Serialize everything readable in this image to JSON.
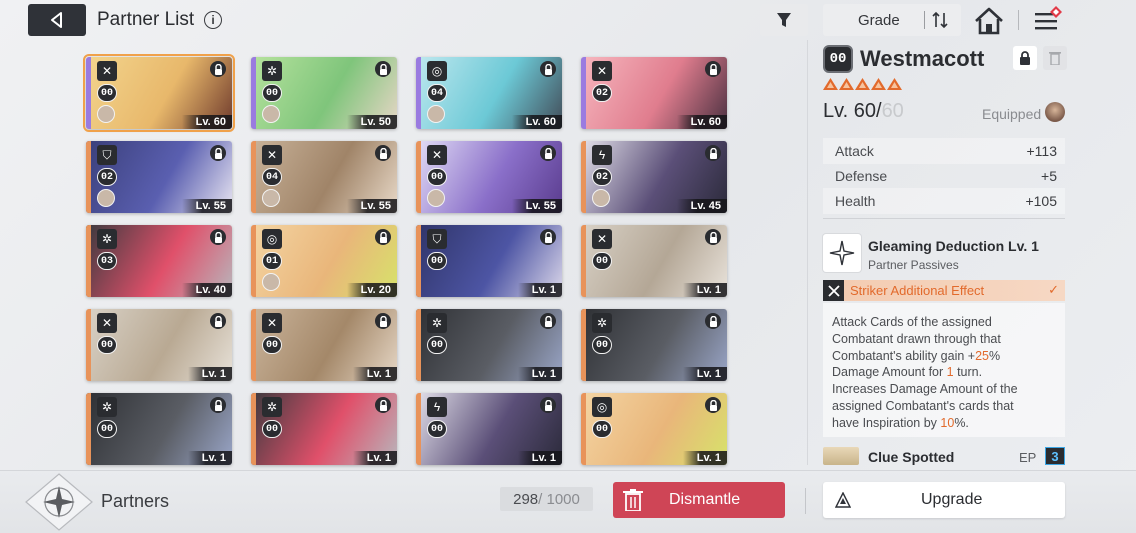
{
  "header": {
    "title": "Partner List",
    "sort_label": "Grade"
  },
  "partners": [
    {
      "grade": "00",
      "level": "Lv. 60",
      "type": "striker",
      "stripe": "#9a7be0",
      "bg": [
        "#f3d58e",
        "#e8b86b",
        "#6f3a2c"
      ],
      "selected": true,
      "equipped": true
    },
    {
      "grade": "00",
      "level": "Lv. 50",
      "type": "gear",
      "stripe": "#9a7be0",
      "bg": [
        "#b7e39e",
        "#7fc57b",
        "#e7d6c6"
      ],
      "selected": false,
      "equipped": true
    },
    {
      "grade": "04",
      "level": "Lv. 60",
      "type": "target",
      "stripe": "#9a7be0",
      "bg": [
        "#bfe8ef",
        "#6cc9d6",
        "#424c58"
      ],
      "selected": false,
      "equipped": true
    },
    {
      "grade": "02",
      "level": "Lv. 60",
      "type": "striker",
      "stripe": "#9a7be0",
      "bg": [
        "#f7b7bf",
        "#e07d8e",
        "#4a3040"
      ],
      "selected": false,
      "equipped": false
    },
    {
      "grade": "02",
      "level": "Lv. 55",
      "type": "shield",
      "stripe": "#e8935a",
      "bg": [
        "#3a3f7a",
        "#5a5fb0",
        "#e9e6f2"
      ],
      "selected": false,
      "equipped": true
    },
    {
      "grade": "04",
      "level": "Lv. 55",
      "type": "striker",
      "stripe": "#e8935a",
      "bg": [
        "#c9b39a",
        "#a08468",
        "#e8d9c8"
      ],
      "selected": false,
      "equipped": true
    },
    {
      "grade": "00",
      "level": "Lv. 55",
      "type": "striker",
      "stripe": "#e8935a",
      "bg": [
        "#e3def6",
        "#8a6fc9",
        "#5a3c8e"
      ],
      "selected": false,
      "equipped": true
    },
    {
      "grade": "02",
      "level": "Lv. 45",
      "type": "bolt",
      "stripe": "#e8935a",
      "bg": [
        "#e3e1ea",
        "#5b4f78",
        "#2b2a3a"
      ],
      "selected": false,
      "equipped": true
    },
    {
      "grade": "03",
      "level": "Lv. 40",
      "type": "gear",
      "stripe": "#e8935a",
      "bg": [
        "#3a3a3e",
        "#e0506a",
        "#b8b6bc"
      ],
      "selected": false,
      "equipped": false
    },
    {
      "grade": "01",
      "level": "Lv. 20",
      "type": "target",
      "stripe": "#e8935a",
      "bg": [
        "#f4d5a4",
        "#e9b67a",
        "#d7e36a"
      ],
      "selected": false,
      "equipped": true
    },
    {
      "grade": "00",
      "level": "Lv. 1",
      "type": "shield",
      "stripe": "#e8935a",
      "bg": [
        "#2f3468",
        "#4d55a4",
        "#dcd8ea"
      ],
      "selected": false,
      "equipped": false
    },
    {
      "grade": "00",
      "level": "Lv. 1",
      "type": "striker",
      "stripe": "#e8935a",
      "bg": [
        "#d9d2c7",
        "#b4a796",
        "#e9e3db"
      ],
      "selected": false,
      "equipped": false
    },
    {
      "grade": "00",
      "level": "Lv. 1",
      "type": "striker",
      "stripe": "#e8935a",
      "bg": [
        "#d9d2c7",
        "#b9a993",
        "#e7e1d8"
      ],
      "selected": false,
      "equipped": false
    },
    {
      "grade": "00",
      "level": "Lv. 1",
      "type": "striker",
      "stripe": "#e8935a",
      "bg": [
        "#cbb59c",
        "#a48869",
        "#e6d7c6"
      ],
      "selected": false,
      "equipped": false
    },
    {
      "grade": "00",
      "level": "Lv. 1",
      "type": "gear",
      "stripe": "#e8935a",
      "bg": [
        "#2e3034",
        "#5a5d64",
        "#9aa6c8"
      ],
      "selected": false,
      "equipped": false
    },
    {
      "grade": "00",
      "level": "Lv. 1",
      "type": "gear",
      "stripe": "#e8935a",
      "bg": [
        "#2e3034",
        "#5a5d64",
        "#9aa6c8"
      ],
      "selected": false,
      "equipped": false
    },
    {
      "grade": "00",
      "level": "Lv. 1",
      "type": "gear",
      "stripe": "#e8935a",
      "bg": [
        "#2e3034",
        "#5a5d64",
        "#9aa6c8"
      ],
      "selected": false,
      "equipped": false
    },
    {
      "grade": "00",
      "level": "Lv. 1",
      "type": "gear",
      "stripe": "#e8935a",
      "bg": [
        "#3a3a3e",
        "#e0506a",
        "#b8b6bc"
      ],
      "selected": false,
      "equipped": false
    },
    {
      "grade": "00",
      "level": "Lv. 1",
      "type": "bolt",
      "stripe": "#e8935a",
      "bg": [
        "#e3e1ea",
        "#5b4f78",
        "#2b2a3a"
      ],
      "selected": false,
      "equipped": false
    },
    {
      "grade": "00",
      "level": "Lv. 1",
      "type": "target",
      "stripe": "#e8935a",
      "bg": [
        "#f4d5a4",
        "#e9b67a",
        "#d7e36a"
      ],
      "selected": false,
      "equipped": false
    }
  ],
  "detail": {
    "grade": "00",
    "name": "Westmacott",
    "stars": 5,
    "level_current": "Lv. 60/",
    "level_max": "60",
    "equipped_label": "Equipped",
    "stats": [
      {
        "name": "Attack",
        "value": "+113"
      },
      {
        "name": "Defense",
        "value": "+5"
      },
      {
        "name": "Health",
        "value": "+105"
      }
    ],
    "skill_name": "Gleaming Deduction Lv. 1",
    "skill_category": "Partner Passives",
    "effect_label": "Striker Additional Effect",
    "desc_line1": "Attack Cards of the assigned",
    "desc_line2": "Combatant drawn through that",
    "desc_line3_pre": "Combatant's ability gain +",
    "desc_line3_hl": "25",
    "desc_line3_post": "%",
    "desc_line4_pre": "Damage Amount for ",
    "desc_line4_hl": "1",
    "desc_line4_post": " turn.",
    "desc_line5": "Increases Damage Amount of the",
    "desc_line6": "assigned Combatant's cards that",
    "desc_line7_pre": "have Inspiration by ",
    "desc_line7_hl": "10",
    "desc_line7_post": "%.",
    "next_skill_name": "Clue Spotted",
    "ep_label": "EP",
    "ep_value": "3"
  },
  "footer": {
    "partners_label": "Partners",
    "count_current": "298",
    "count_total": " / 1000",
    "dismantle_label": "Dismantle",
    "upgrade_label": "Upgrade"
  },
  "colors": {
    "accent_orange": "#e26a2c",
    "dismantle_red": "#cf4556",
    "selected_outline": "#f0a14a",
    "ep_blue": "#3ca7e6"
  }
}
